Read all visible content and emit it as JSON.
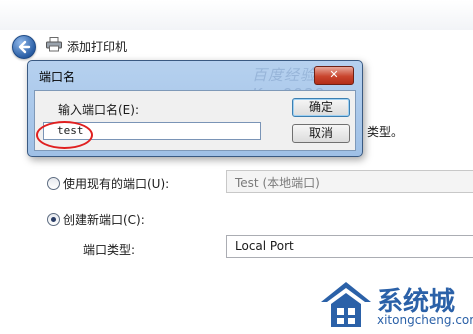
{
  "wizard": {
    "title": "添加打印机",
    "port_type_suffix": "类型。",
    "use_existing_label": "使用现有的端口(U):",
    "existing_port_value": "Test (本地端口)",
    "create_new_label": "创建新端口(C):",
    "port_type_label": "端口类型:",
    "port_type_value": "Local Port"
  },
  "dialog": {
    "title": "端口名",
    "close_label": "✕",
    "field_label": "输入端口名(E):",
    "input_value": "test",
    "ok_label": "确定",
    "cancel_label": "取消",
    "watermark": "百度经验 by Kay9928"
  },
  "logo": {
    "name": "系统城",
    "url_text": "xitongcheng.com"
  },
  "colors": {
    "dialog_frame": "#b6d1ef",
    "close_button": "#c9452e",
    "annotation_circle": "#e02020",
    "logo": "#2b61a8"
  }
}
